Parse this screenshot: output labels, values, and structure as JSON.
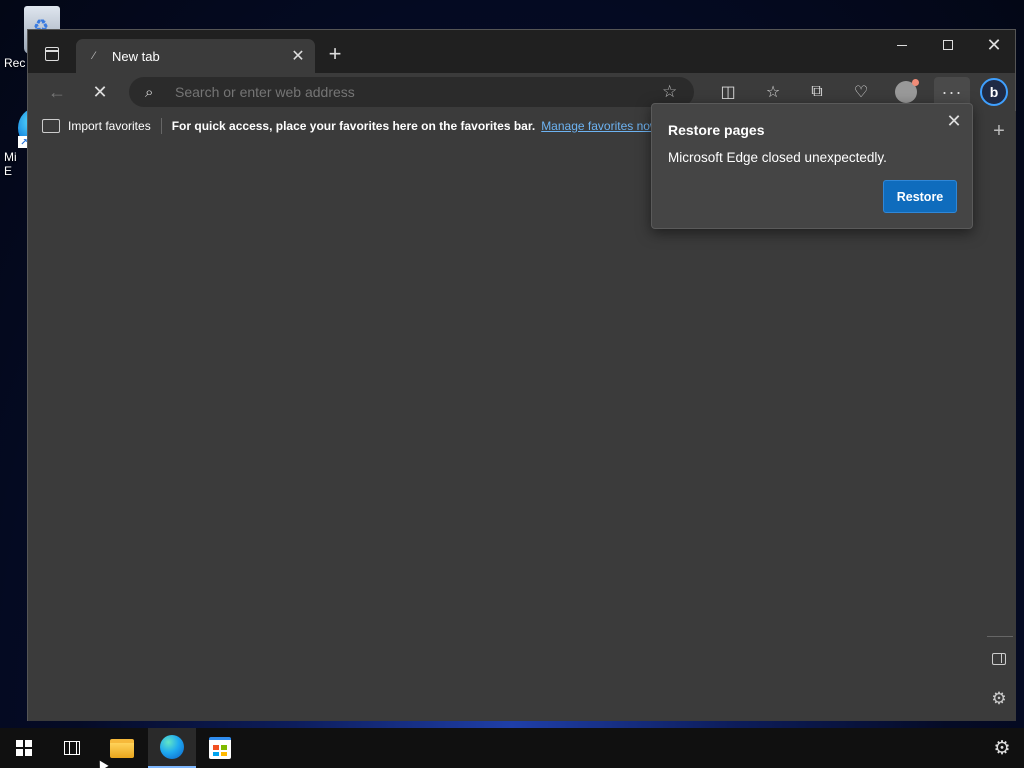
{
  "desktop": {
    "icons": [
      {
        "label": "Rec",
        "name": "recycle-bin"
      },
      {
        "label": "Mi\nE",
        "name": "microsoft-edge"
      }
    ]
  },
  "browser": {
    "tab": {
      "title": "New tab",
      "loading_icon": "spinner-icon"
    },
    "address_bar": {
      "placeholder": "Search or enter web address",
      "value": ""
    },
    "toolbar_icons": [
      "back-icon",
      "stop-icon",
      "favorite-star-icon",
      "split-screen-icon",
      "favorites-icon",
      "collections-icon",
      "performance-icon",
      "profile-icon",
      "more-icon",
      "copilot-icon"
    ],
    "favorites_bar": {
      "import_label": "Import favorites",
      "hint": "For quick access, place your favorites here on the favorites bar.",
      "manage_link": "Manage favorites now"
    },
    "window_controls": [
      "minimize",
      "maximize",
      "close"
    ]
  },
  "restore_popup": {
    "title": "Restore pages",
    "message": "Microsoft Edge closed unexpectedly.",
    "button_label": "Restore",
    "accent_color": "#0f6cbd"
  },
  "taskbar": {
    "items": [
      "start",
      "task-view",
      "file-explorer",
      "microsoft-edge",
      "microsoft-store"
    ],
    "active": "microsoft-edge"
  }
}
